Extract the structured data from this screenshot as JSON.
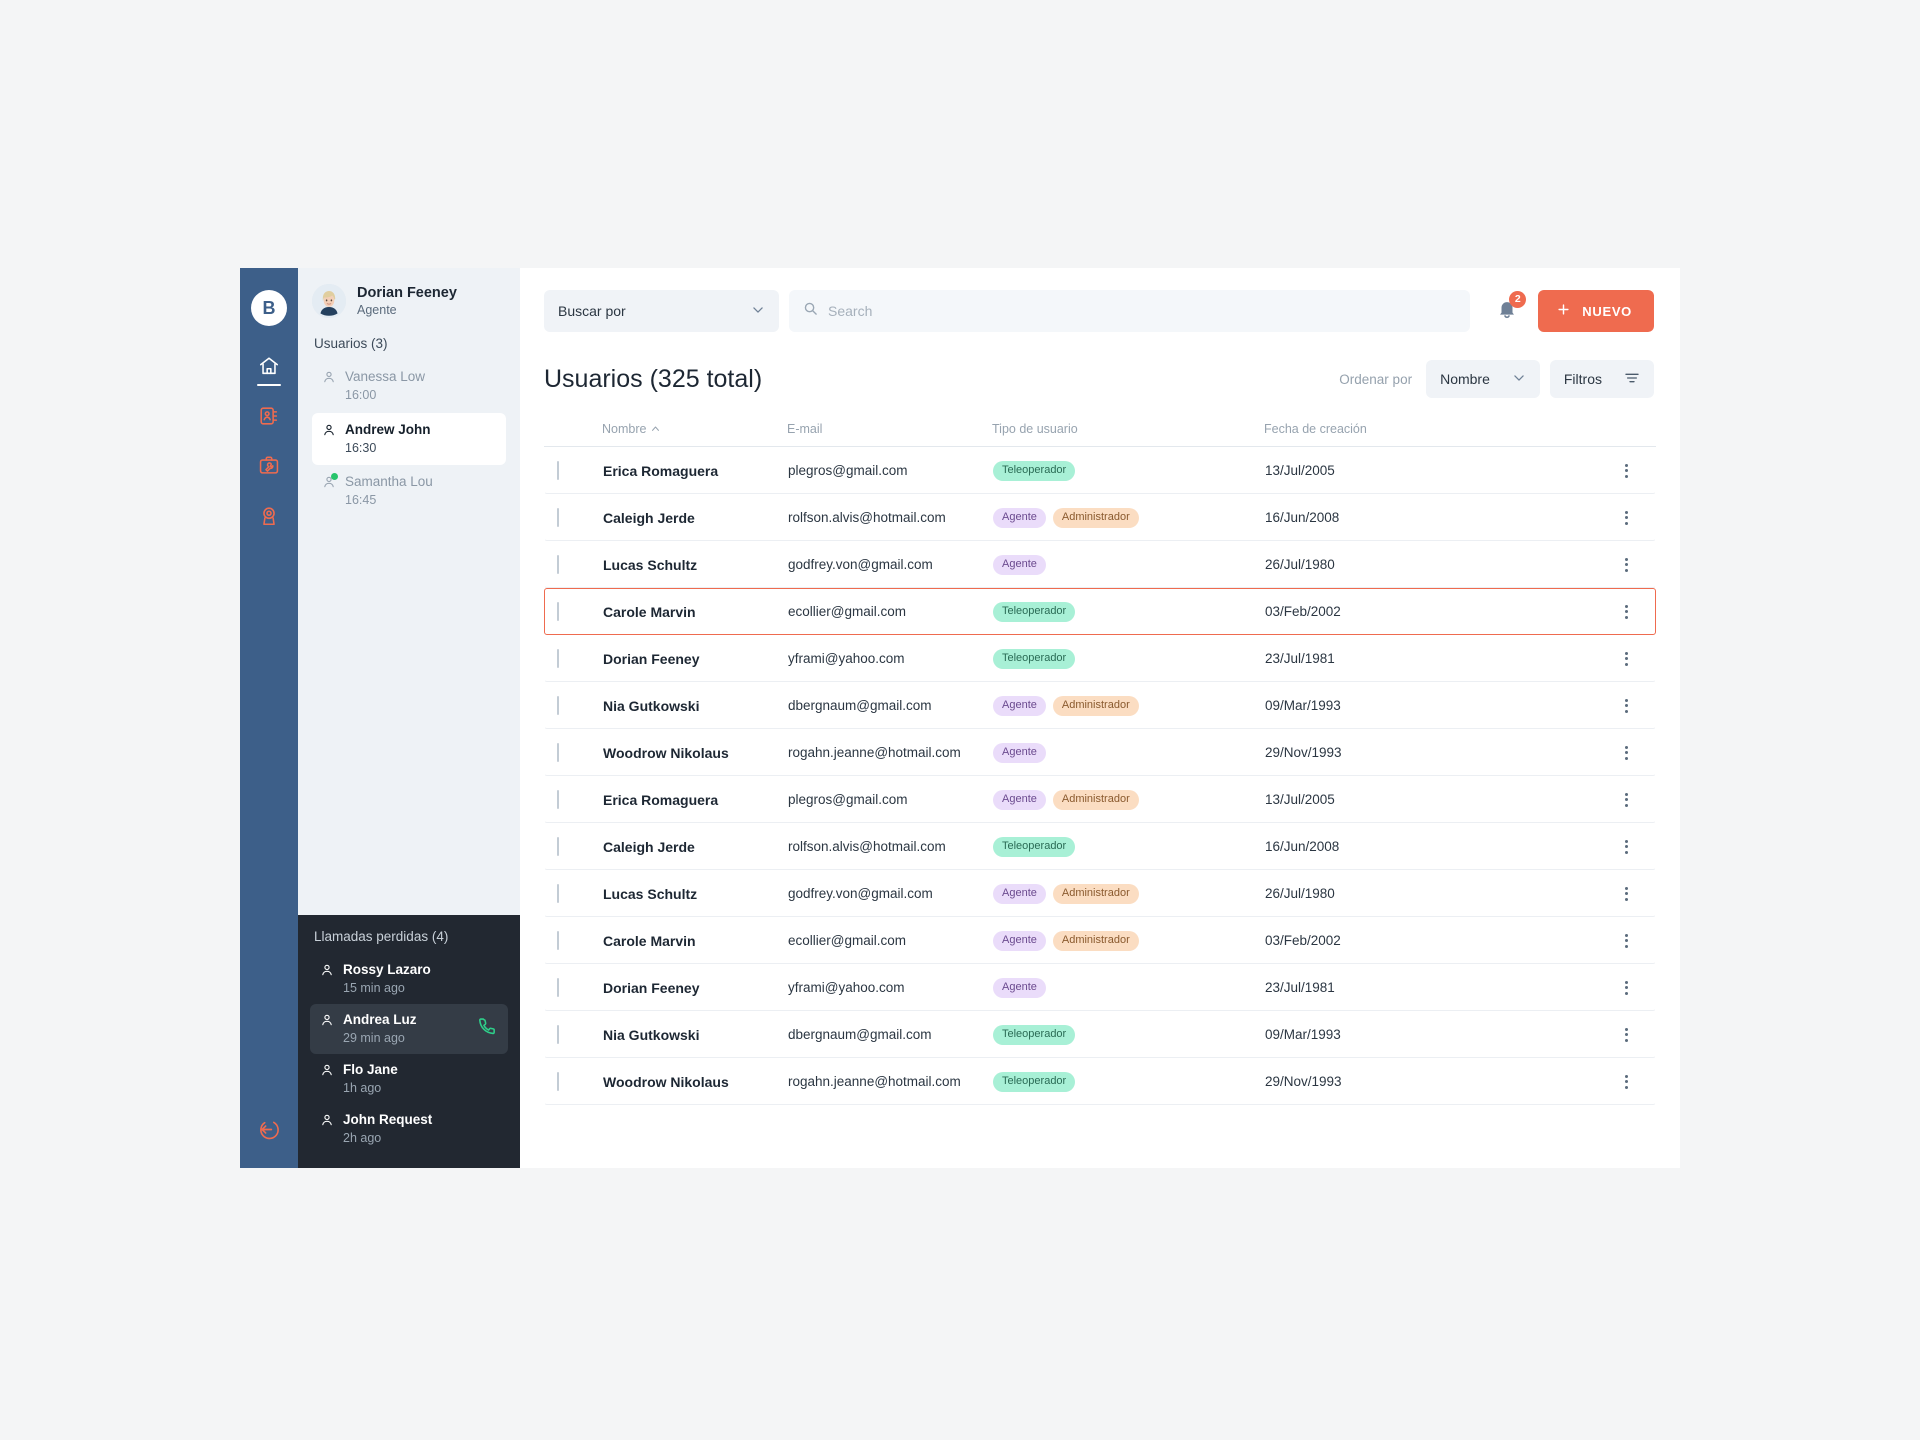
{
  "rail": {
    "logo_text": "B",
    "items": [
      {
        "name": "home-icon",
        "label": "Inicio",
        "active": true
      },
      {
        "name": "contacts-icon",
        "label": "Contactos",
        "active": false
      },
      {
        "name": "toolbox-icon",
        "label": "Herramientas",
        "active": false
      },
      {
        "name": "support-icon",
        "label": "Soporte",
        "active": false
      }
    ],
    "logout_label": "Salir"
  },
  "panel": {
    "profile": {
      "name": "Dorian Feeney",
      "role": "Agente"
    },
    "users_title": "Usuarios (3)",
    "users": [
      {
        "name": "Vanessa Low",
        "time": "16:00",
        "selected": false,
        "online": false
      },
      {
        "name": "Andrew John",
        "time": "16:30",
        "selected": true,
        "online": false
      },
      {
        "name": "Samantha Lou",
        "time": "16:45",
        "selected": false,
        "online": true
      }
    ],
    "missed_title": "Llamadas perdidas (4)",
    "missed": [
      {
        "name": "Rossy Lazaro",
        "time": "15 min ago",
        "active": false,
        "call": false
      },
      {
        "name": "Andrea Luz",
        "time": "29 min ago",
        "active": true,
        "call": true
      },
      {
        "name": "Flo Jane",
        "time": "1h ago",
        "active": false,
        "call": false
      },
      {
        "name": "John Request",
        "time": "2h ago",
        "active": false,
        "call": false
      }
    ]
  },
  "toolbar": {
    "select_label": "Buscar por",
    "search_placeholder": "Search",
    "search_value": "",
    "notification_count": "2",
    "new_label": "NUEVO"
  },
  "header": {
    "title": "Usuarios (325 total)",
    "sort_label": "Ordenar por",
    "sort_value": "Nombre",
    "filters_label": "Filtros"
  },
  "table": {
    "columns": [
      "Nombre",
      "E-mail",
      "Tipo de usuario",
      "Fecha de creación"
    ],
    "sort_column": "Nombre",
    "sort_direction": "asc",
    "rows": [
      {
        "name": "Erica Romaguera",
        "email": "plegros@gmail.com",
        "types": [
          "Teleoperador"
        ],
        "date": "13/Jul/2005",
        "highlight": false
      },
      {
        "name": "Caleigh Jerde",
        "email": "rolfson.alvis@hotmail.com",
        "types": [
          "Agente",
          "Administrador"
        ],
        "date": "16/Jun/2008",
        "highlight": false
      },
      {
        "name": "Lucas Schultz",
        "email": "godfrey.von@gmail.com",
        "types": [
          "Agente"
        ],
        "date": "26/Jul/1980",
        "highlight": false
      },
      {
        "name": "Carole Marvin",
        "email": "ecollier@gmail.com",
        "types": [
          "Teleoperador"
        ],
        "date": "03/Feb/2002",
        "highlight": true
      },
      {
        "name": "Dorian Feeney",
        "email": "yframi@yahoo.com",
        "types": [
          "Teleoperador"
        ],
        "date": "23/Jul/1981",
        "highlight": false
      },
      {
        "name": "Nia Gutkowski",
        "email": "dbergnaum@gmail.com",
        "types": [
          "Agente",
          "Administrador"
        ],
        "date": "09/Mar/1993",
        "highlight": false
      },
      {
        "name": "Woodrow Nikolaus",
        "email": "rogahn.jeanne@hotmail.com",
        "types": [
          "Agente"
        ],
        "date": "29/Nov/1993",
        "highlight": false
      },
      {
        "name": "Erica Romaguera",
        "email": "plegros@gmail.com",
        "types": [
          "Agente",
          "Administrador"
        ],
        "date": "13/Jul/2005",
        "highlight": false
      },
      {
        "name": "Caleigh Jerde",
        "email": "rolfson.alvis@hotmail.com",
        "types": [
          "Teleoperador"
        ],
        "date": "16/Jun/2008",
        "highlight": false
      },
      {
        "name": "Lucas Schultz",
        "email": "godfrey.von@gmail.com",
        "types": [
          "Agente",
          "Administrador"
        ],
        "date": "26/Jul/1980",
        "highlight": false
      },
      {
        "name": "Carole Marvin",
        "email": "ecollier@gmail.com",
        "types": [
          "Agente",
          "Administrador"
        ],
        "date": "03/Feb/2002",
        "highlight": false
      },
      {
        "name": "Dorian Feeney",
        "email": "yframi@yahoo.com",
        "types": [
          "Agente"
        ],
        "date": "23/Jul/1981",
        "highlight": false
      },
      {
        "name": "Nia Gutkowski",
        "email": "dbergnaum@gmail.com",
        "types": [
          "Teleoperador"
        ],
        "date": "09/Mar/1993",
        "highlight": false
      },
      {
        "name": "Woodrow Nikolaus",
        "email": "rogahn.jeanne@hotmail.com",
        "types": [
          "Teleoperador"
        ],
        "date": "29/Nov/1993",
        "highlight": false
      }
    ]
  },
  "colors": {
    "accent": "#ef6b4f",
    "rail": "#3d5f89",
    "panel": "#eef2f6",
    "missed_panel": "#222831",
    "badge_teleoperador": "#a8f0d6",
    "badge_agente": "#eadcfa",
    "badge_administrador": "#fbddc2",
    "online": "#27c46b"
  }
}
